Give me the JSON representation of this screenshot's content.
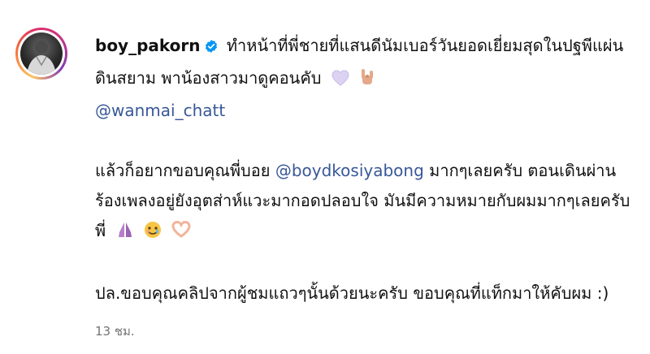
{
  "post": {
    "username": "boy_pakorn",
    "p1": {
      "text": "ทำหน้าที่พี่ชายที่แสนดีนัมเบอร์วันยอดเยี่ยมสุดในปฐพีแผ่นดินสยาม พาน้องสาวมาดูคอนคับ",
      "emojis": [
        "light-purple-heart",
        "rock-on-hand"
      ],
      "mention": "@wanmai_chatt"
    },
    "p2": {
      "text_a": "แล้วก็อยากขอบคุณพี่บอย",
      "mention": "@boydkosiyabong",
      "text_b": "มากๆเลยครับ ตอนเดินผ่านร้องเพลงอยู่ยังอุตส่าห์แวะมากอดปลอบใจ มันมีความหมายกับผมมากๆเลยครับพี่",
      "emojis": [
        "folded-hands",
        "smiling-face-with-tear",
        "heart-hands"
      ]
    },
    "p3": {
      "text": "ปล.ขอบคุณคลิปจากผู้ชมแถวๆนั้นด้วยนะครับ ขอบคุณที่แท็กมาให้คับผม :)"
    },
    "timestamp": "13 ชม."
  },
  "colors": {
    "mention": "#385898",
    "verified": "#0095f6",
    "timestamp": "#737373"
  }
}
